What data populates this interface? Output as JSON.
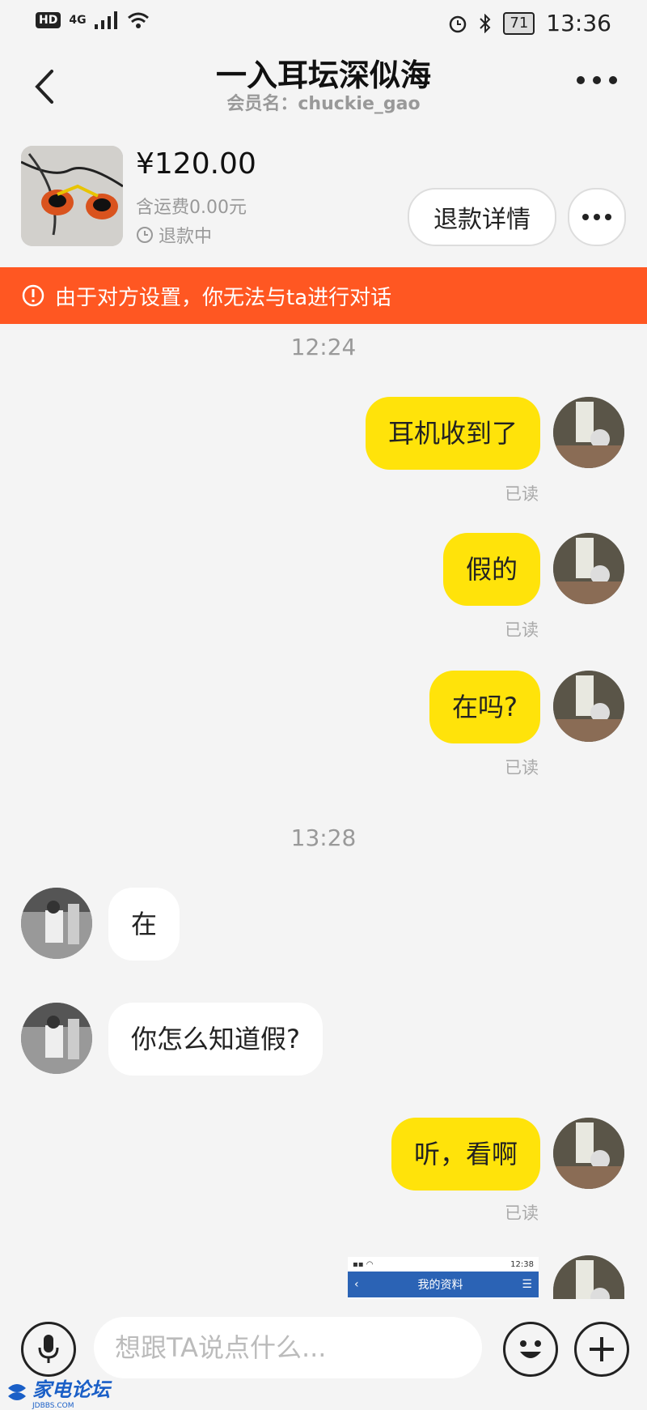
{
  "status_bar": {
    "hd": "HD",
    "network": "4G",
    "battery": "71",
    "time": "13:36"
  },
  "header": {
    "title": "一入耳坛深似海",
    "subtitle": "会员名：chuckie_gao"
  },
  "order": {
    "price": "¥120.00",
    "shipping": "含运费0.00元",
    "status": "退款中",
    "refund_button": "退款详情"
  },
  "banner": {
    "text": "由于对方设置，你无法与ta进行对话"
  },
  "messages": {
    "ts1": "12:24",
    "m1": "耳机收到了",
    "m2": "假的",
    "m3": "在吗?",
    "ts2": "13:28",
    "m4": "在",
    "m5": "你怎么知道假?",
    "m6": "听，看啊",
    "read": "已读",
    "image_preview": {
      "time": "12:38",
      "title": "我的资料"
    }
  },
  "input": {
    "placeholder": "想跟TA说点什么..."
  },
  "watermark": {
    "name": "家电论坛",
    "domain": "JDBBS.COM"
  },
  "colors": {
    "accent": "#ffe30a",
    "banner": "#ff5722",
    "link": "#2b63b5"
  }
}
